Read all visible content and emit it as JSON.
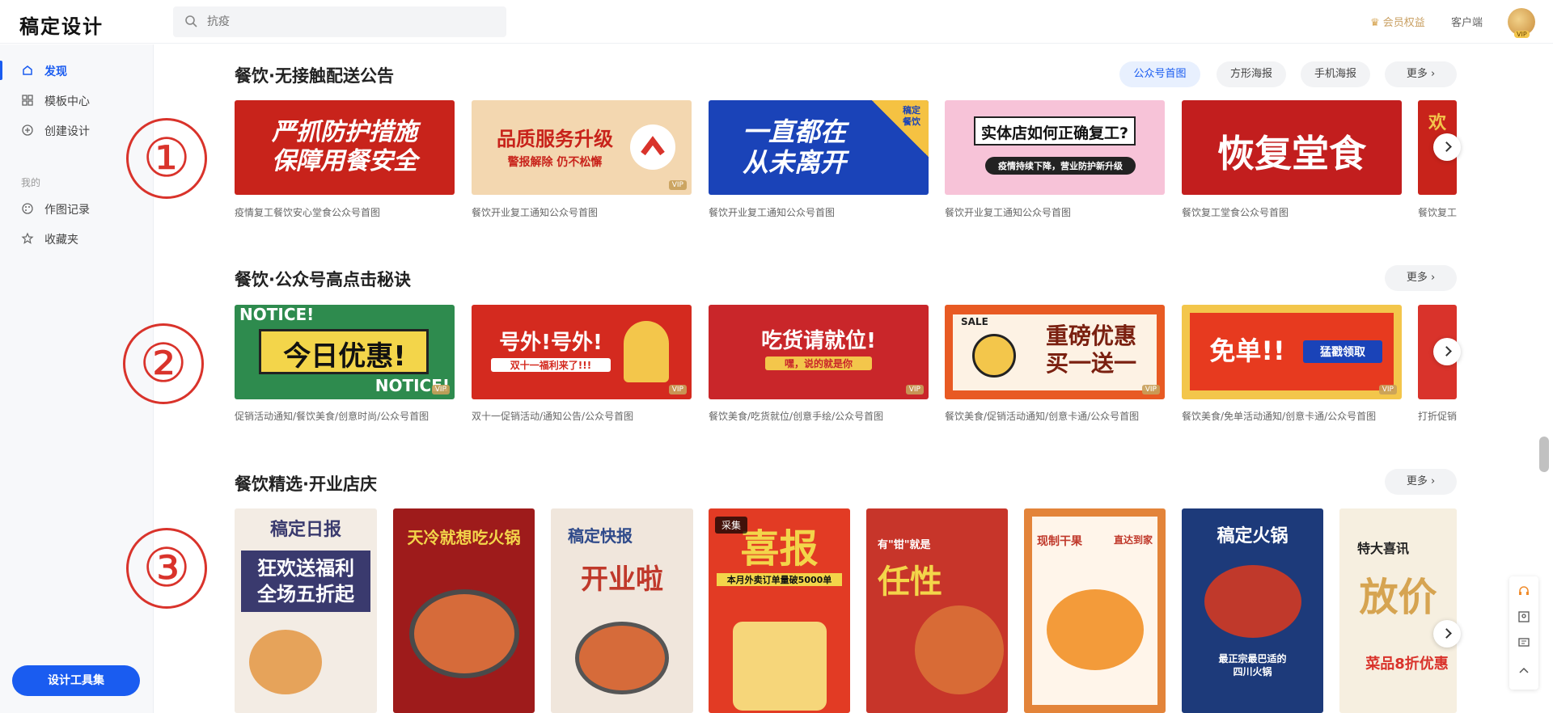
{
  "app": {
    "logo": "稿定设计"
  },
  "search": {
    "placeholder": "抗疫"
  },
  "header": {
    "vip_link": "会员权益",
    "client_link": "客户端",
    "avatar_badge": "VIP"
  },
  "sidebar": {
    "items": [
      {
        "label": "发现",
        "icon": "compass-icon",
        "active": true
      },
      {
        "label": "模板中心",
        "icon": "grid-icon"
      },
      {
        "label": "创建设计",
        "icon": "plus-circle-icon"
      }
    ],
    "group_label": "我的",
    "my_items": [
      {
        "label": "作图记录",
        "icon": "palette-icon"
      },
      {
        "label": "收藏夹",
        "icon": "star-icon"
      }
    ],
    "tool_button": "设计工具集"
  },
  "annotations": [
    "①",
    "②",
    "③"
  ],
  "sections": [
    {
      "title": "餐饮·无接触配送公告",
      "filters": [
        "公众号首图",
        "方形海报",
        "手机海报"
      ],
      "more": "更多",
      "cards": [
        {
          "caption": "疫情复工餐饮安心堂食公众号首图",
          "text": "严抓防护措施\n保障用餐安全",
          "bg": "#c8231b"
        },
        {
          "caption": "餐饮开业复工通知公众号首图",
          "text": "品质服务升级",
          "sub": "警报解除 仍不松懈",
          "bg": "#f3d7b0",
          "vip": true
        },
        {
          "caption": "餐饮开业复工通知公众号首图",
          "text": "一直都在\n从未离开",
          "bg": "#1a43b8",
          "corner": "稿定\n餐饮"
        },
        {
          "caption": "餐饮开业复工通知公众号首图",
          "text": "实体店如何正确复工?",
          "sub": "疫情持续下降，营业防护新升级",
          "bg": "#f7c3d8"
        },
        {
          "caption": "餐饮复工堂食公众号首图",
          "text": "恢复堂食",
          "bg": "#c21e1e"
        },
        {
          "caption": "餐饮复工",
          "text": "欢",
          "bg": "#c8231b"
        }
      ]
    },
    {
      "title": "餐饮·公众号高点击秘诀",
      "more": "更多",
      "cards": [
        {
          "caption": "促销活动通知/餐饮美食/创意时尚/公众号首图",
          "text": "今日优惠!",
          "top": "NOTICE!",
          "bottom": "NOTICE!",
          "bg": "#2e8b4e",
          "vip": true
        },
        {
          "caption": "双十一促销活动/通知公告/公众号首图",
          "text": "号外!号外!",
          "sub": "双十一福利来了!!!",
          "bg": "#d42a1f",
          "vip": true
        },
        {
          "caption": "餐饮美食/吃货就位/创意手绘/公众号首图",
          "text": "吃货请就位!",
          "sub": "嘿，说的就是你",
          "bg": "#c9262a",
          "vip": true
        },
        {
          "caption": "餐饮美食/促销活动通知/创意卡通/公众号首图",
          "text": "重磅优惠\n买一送一",
          "top": "SALE",
          "bg": "#e85a23",
          "vip": true
        },
        {
          "caption": "餐饮美食/免单活动通知/创意卡通/公众号首图",
          "text": "免单!!",
          "sub": "猛戳领取",
          "bg": "#e73a1f",
          "vip": true
        },
        {
          "caption": "打折促销",
          "text": "",
          "bg": "#d9332b"
        }
      ]
    },
    {
      "title": "餐饮精选·开业店庆",
      "more": "更多",
      "cards": [
        {
          "text": "稿定日报",
          "sub": "狂欢送福利\n全场五折起",
          "bg": "#f3ece4",
          "color": "#3a3a6e"
        },
        {
          "text": "天冷就想吃火锅",
          "bg": "#9e1b1b"
        },
        {
          "text": "稿定快报",
          "sub": "开业啦",
          "bg": "#f0e6dc",
          "color": "#c0392b"
        },
        {
          "text": "喜报",
          "sub": "本月外卖订单量破5000单",
          "bg": "#e23b24",
          "tag": "采集"
        },
        {
          "text": "任性",
          "sub": "有\"钳\"就是",
          "bg": "#c7352a"
        },
        {
          "text": "现制干果",
          "sub": "直达到家",
          "bg": "#e3843a"
        },
        {
          "text": "稿定火锅",
          "sub": "最正宗最巴适的\n四川火锅",
          "bg": "#1d3a7a"
        },
        {
          "text": "放价",
          "sub": "特大喜讯",
          "bottom": "菜品8折优惠",
          "bg": "#f6efe0"
        }
      ]
    }
  ]
}
